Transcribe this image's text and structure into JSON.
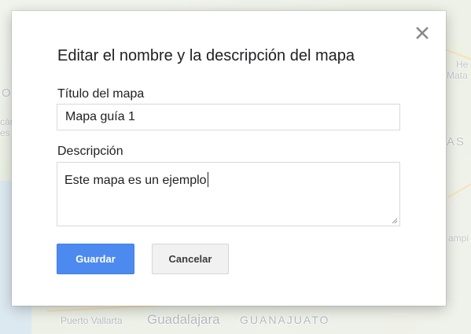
{
  "map": {
    "labels": {
      "puerto_vallarta": "Puerto Vallarta",
      "guadalajara": "Guadalajara",
      "guanajuato": "GUANAJUATO"
    },
    "edge_fragments": {
      "right_top_1": "He",
      "right_top_2": "Mata",
      "left_mid_1": "O",
      "left_mid_2": "cár",
      "left_mid_3": "es",
      "right_mid": "AS",
      "right_low": "ampi"
    }
  },
  "dialog": {
    "title": "Editar el nombre y la descripción del mapa",
    "close_icon": "close-icon",
    "map_title_label": "Título del mapa",
    "map_title_value": "Mapa guía 1",
    "description_label": "Descripción",
    "description_value": "Este mapa es un ejemplo",
    "save_label": "Guardar",
    "cancel_label": "Cancelar"
  },
  "colors": {
    "primary_button": "#4d8af0",
    "secondary_button": "#f1f1f1",
    "text": "#202124"
  }
}
